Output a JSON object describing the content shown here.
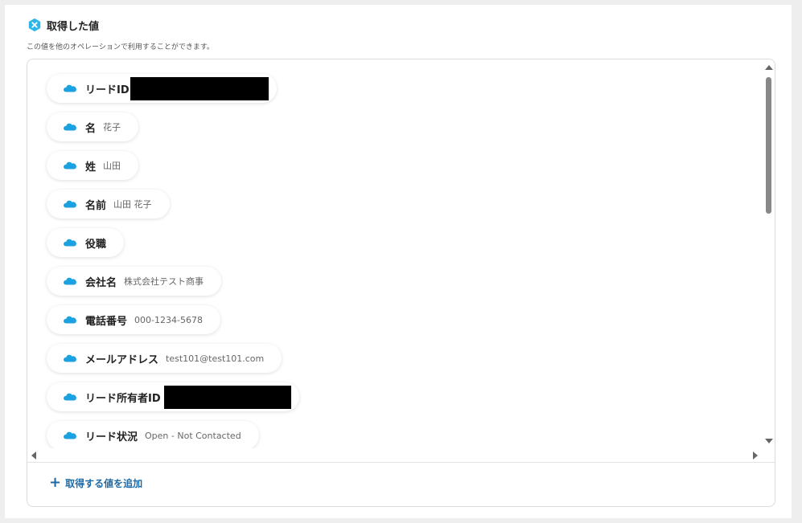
{
  "header": {
    "title": "取得した値",
    "icon": "x-badge-icon",
    "accent_color": "#2fb6e8"
  },
  "subtitle": "この値を他のオペレーションで利用することができます。",
  "fields": [
    {
      "label": "リードID",
      "value": "",
      "redacted": true
    },
    {
      "label": "名",
      "value": "花子",
      "redacted": false
    },
    {
      "label": "姓",
      "value": "山田",
      "redacted": false
    },
    {
      "label": "名前",
      "value": "山田 花子",
      "redacted": false
    },
    {
      "label": "役職",
      "value": "",
      "redacted": false
    },
    {
      "label": "会社名",
      "value": "株式会社テスト商事",
      "redacted": false
    },
    {
      "label": "電話番号",
      "value": "000-1234-5678",
      "redacted": false
    },
    {
      "label": "メールアドレス",
      "value": "test101@test101.com",
      "redacted": false
    },
    {
      "label": "リード所有者ID",
      "value": "",
      "redacted": true
    },
    {
      "label": "リード状況",
      "value": "Open - Not Contacted",
      "redacted": false
    }
  ],
  "field_icon": "salesforce-cloud-icon",
  "field_icon_color": "#1ba1e2",
  "add_button": {
    "label": "取得する値を追加",
    "icon": "plus-icon",
    "color": "#1f6aa5"
  }
}
